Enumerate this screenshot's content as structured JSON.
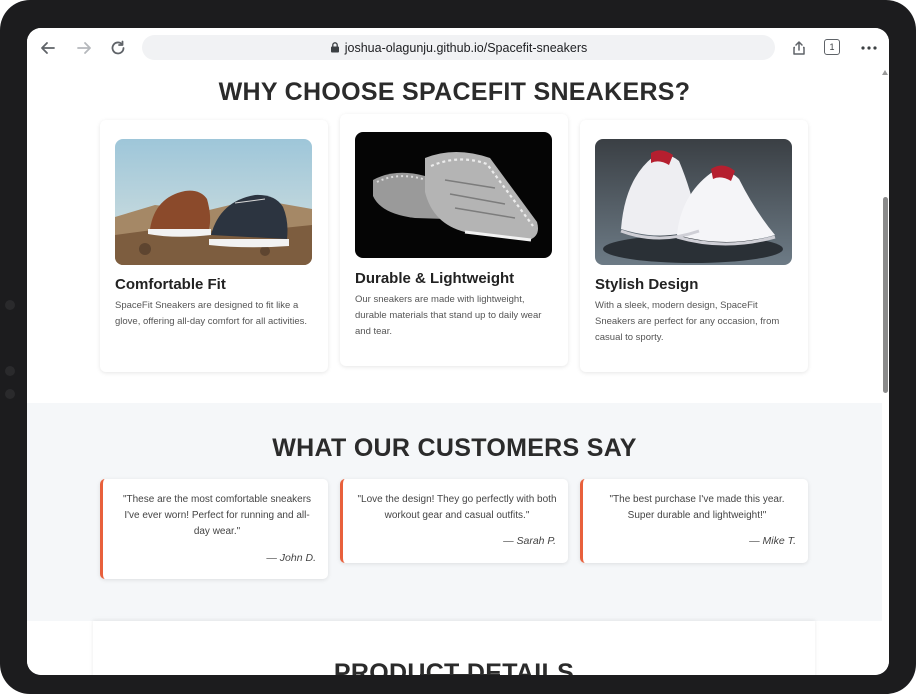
{
  "browser": {
    "url": "joshua-olagunju.github.io/Spacefit-sneakers",
    "tab_count": "1"
  },
  "features": {
    "heading": "WHY CHOOSE SPACEFIT SNEAKERS?",
    "cards": [
      {
        "title": "Comfortable Fit",
        "text": "SpaceFit Sneakers are designed to fit like a glove, offering all-day comfort for all activities."
      },
      {
        "title": "Durable & Lightweight",
        "text": "Our sneakers are made with lightweight, durable materials that stand up to daily wear and tear."
      },
      {
        "title": "Stylish Design",
        "text": "With a sleek, modern design, SpaceFit Sneakers are perfect for any occasion, from casual to sporty."
      }
    ]
  },
  "testimonials": {
    "heading": "WHAT OUR CUSTOMERS SAY",
    "items": [
      {
        "quote": "\"These are the most comfortable sneakers I've ever worn! Perfect for running and all-day wear.\"",
        "author": "— John D."
      },
      {
        "quote": "\"Love the design! They go perfectly with both workout gear and casual outfits.\"",
        "author": "— Sarah P."
      },
      {
        "quote": "\"The best purchase I've made this year. Super durable and lightweight!\"",
        "author": "— Mike T."
      }
    ]
  },
  "product": {
    "heading": "PRODUCT DETAILS"
  },
  "colors": {
    "accent": "#e8603c",
    "heading": "#2b2b2b",
    "section_bg": "#f5f7f9"
  }
}
